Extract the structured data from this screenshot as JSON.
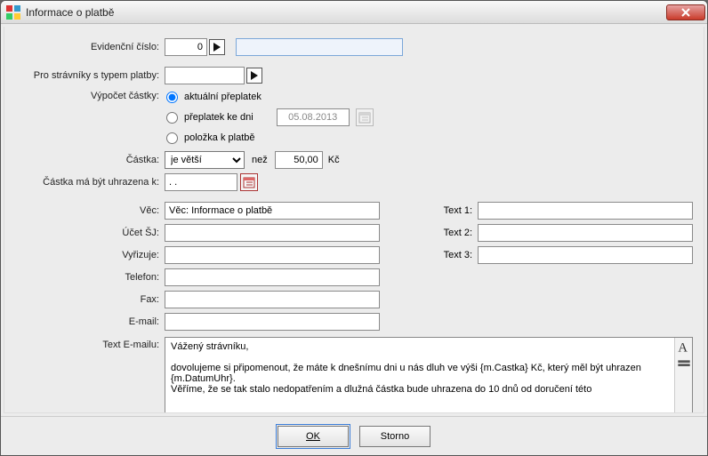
{
  "window": {
    "title": "Informace o platbě"
  },
  "labels": {
    "evid": "Evidenční číslo:",
    "typPlatby": "Pro strávníky s typem platby:",
    "vypocet": "Výpočet částky:",
    "castka": "Částka:",
    "nez": "než",
    "kc": "Kč",
    "castkaDate": "Částka má být uhrazena k:",
    "vec": "Věc:",
    "ucet": "Účet ŠJ:",
    "vyrizuje": "Vyřizuje:",
    "telefon": "Telefon:",
    "fax": "Fax:",
    "email": "E-mail:",
    "textEmailu": "Text E-mailu:",
    "text1": "Text 1:",
    "text2": "Text 2:",
    "text3": "Text 3:"
  },
  "radios": {
    "r1": "aktuální přeplatek",
    "r2": "přeplatek ke dni",
    "r3": "položka k platbě",
    "dateR2": "05.08.2013"
  },
  "values": {
    "evid": "0",
    "evid2": "",
    "typPlatby": "",
    "comparator": "je větší",
    "amount": "50,00",
    "dueDate": ". .",
    "vec": "Věc: Informace o platbě",
    "ucet": "",
    "vyrizuje": "",
    "telefon": "",
    "fax": "",
    "email": "",
    "t1": "",
    "t2": "",
    "t3": "",
    "emailBody": "Vážený strávníku,\n\ndovolujeme si připomenout, že máte k dnešnímu dni u nás dluh ve výši {m.Castka} Kč, který měl být uhrazen {m.DatumUhr}.\nVěříme, že se tak stalo nedopatřením a dlužná částka bude uhrazena do 10 dnů od doručení této"
  },
  "buttons": {
    "ok": "OK",
    "cancel": "Storno"
  }
}
